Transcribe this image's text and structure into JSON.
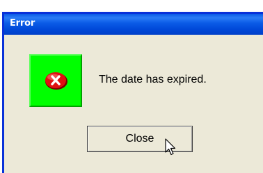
{
  "window": {
    "title": "Error"
  },
  "message": {
    "text": "The date has expired."
  },
  "close_button": {
    "label": "Close"
  },
  "icons": {
    "status": "error-icon",
    "pointer": "mouse-pointer-icon"
  },
  "colors": {
    "titlebar": "#0a5ae6",
    "dialog_bg": "#ece9d8",
    "icon_bg": "#00ff00",
    "error_red": "#e01010"
  }
}
